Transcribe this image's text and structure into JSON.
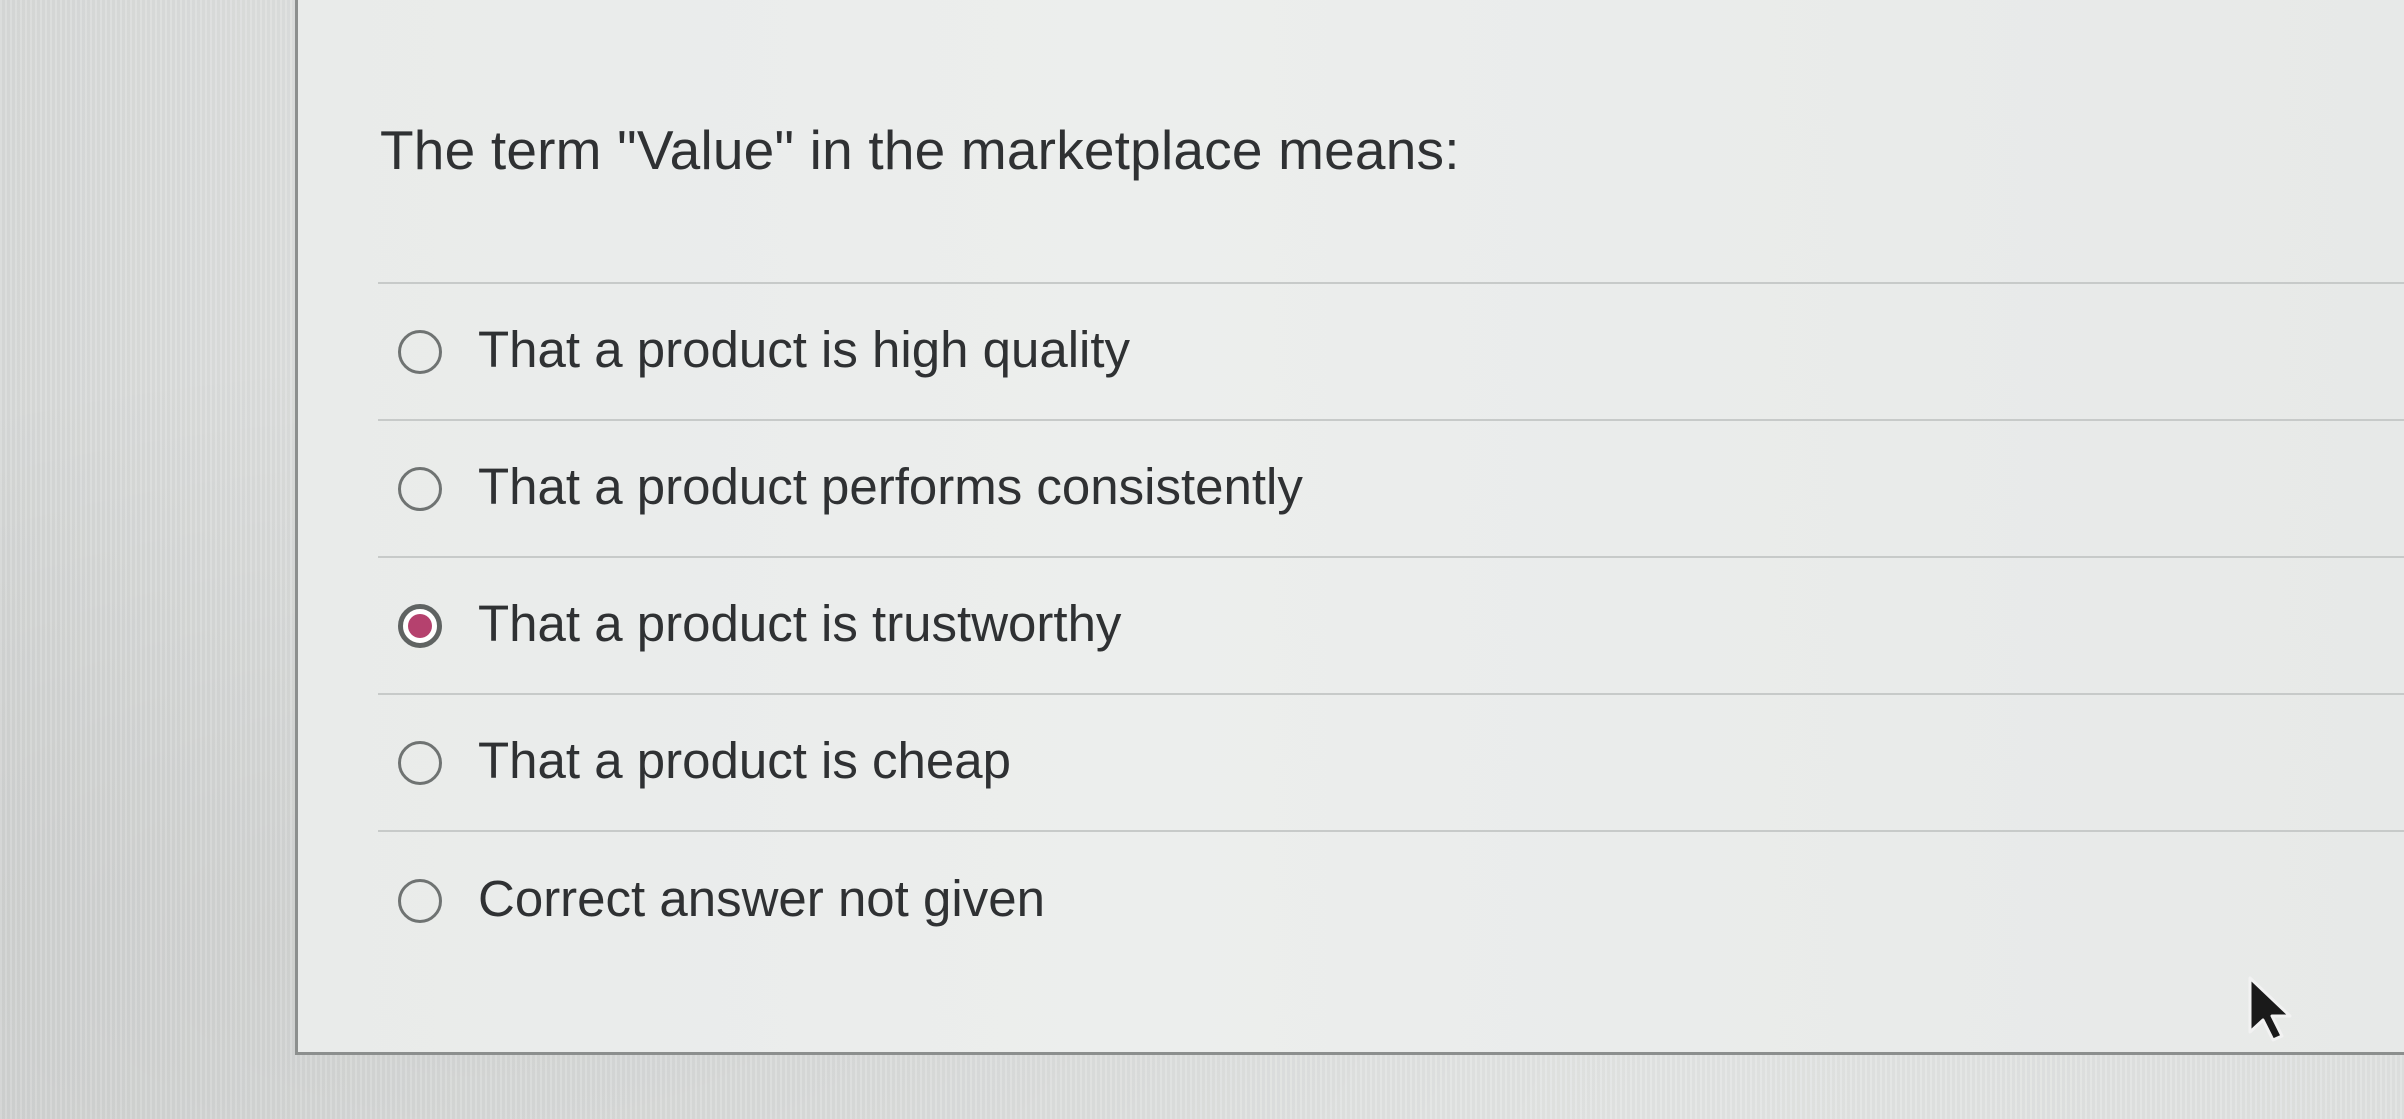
{
  "question": {
    "title": "The term \"Value\" in the marketplace means:"
  },
  "options": [
    {
      "label": "That a product is high quality",
      "selected": false
    },
    {
      "label": "That a product performs consistently",
      "selected": false
    },
    {
      "label": "That a product is trustworthy",
      "selected": true
    },
    {
      "label": "That a product is cheap",
      "selected": false
    },
    {
      "label": "Correct answer not given",
      "selected": false
    }
  ],
  "colors": {
    "selected_radio": "#b5416e",
    "text": "#2f3133",
    "divider": "#c7cac9"
  },
  "icons": {
    "cursor": "mouse-pointer-arrow-icon"
  }
}
